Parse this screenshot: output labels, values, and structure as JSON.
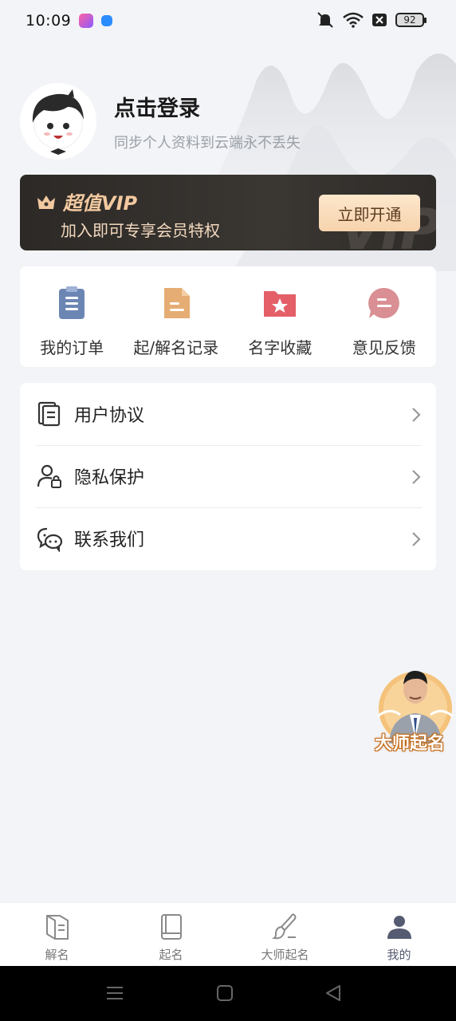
{
  "status_bar": {
    "time": "10:09",
    "battery": "92"
  },
  "profile": {
    "title": "点击登录",
    "subtitle": "同步个人资料到云端永不丢失"
  },
  "vip": {
    "title": "超值VIP",
    "subtitle": "加入即可专享会员特权",
    "button": "立即开通",
    "watermark": "VIP"
  },
  "quick_actions": [
    {
      "label": "我的订单",
      "icon": "order-clipboard-icon",
      "color": "#6c86b3"
    },
    {
      "label": "起/解名记录",
      "icon": "record-document-icon",
      "color": "#e5ad73"
    },
    {
      "label": "名字收藏",
      "icon": "favorite-folder-icon",
      "color": "#e45f68"
    },
    {
      "label": "意见反馈",
      "icon": "feedback-bubble-icon",
      "color": "#d98f93"
    }
  ],
  "menu": [
    {
      "label": "用户协议",
      "icon": "document-icon"
    },
    {
      "label": "隐私保护",
      "icon": "user-lock-icon"
    },
    {
      "label": "联系我们",
      "icon": "chat-icon"
    }
  ],
  "floating_badge": {
    "label": "大师起名"
  },
  "bottom_nav": [
    {
      "label": "解名",
      "icon": "book-open-icon",
      "active": false
    },
    {
      "label": "起名",
      "icon": "book-icon",
      "active": false
    },
    {
      "label": "大师起名",
      "icon": "brush-icon",
      "active": false
    },
    {
      "label": "我的",
      "icon": "person-icon",
      "active": true
    }
  ],
  "colors": {
    "accent": "#555b70",
    "vip_gold": "#f3c9a0",
    "background": "#f3f4f7"
  }
}
